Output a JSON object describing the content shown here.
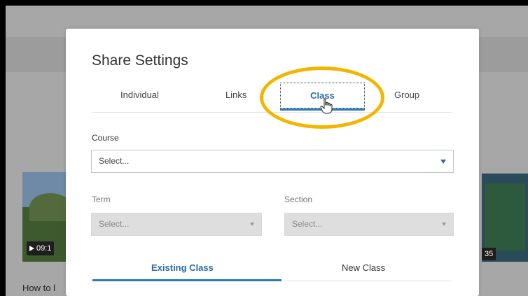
{
  "background": {
    "left_video_duration": "09:1",
    "right_video_duration": "35",
    "caption": "How to l"
  },
  "dialog": {
    "title": "Share Settings",
    "tabs": [
      "Individual",
      "Links",
      "Class",
      "Group"
    ],
    "active_tab": "Class",
    "course_label": "Course",
    "course_value": "Select...",
    "term_label": "Term",
    "term_value": "Select...",
    "section_label": "Section",
    "section_value": "Select...",
    "subtabs": [
      "Existing Class",
      "New Class"
    ],
    "active_subtab": "Existing Class"
  },
  "colors": {
    "accent": "#2a7ac0",
    "highlight": "#f2b600",
    "disabled_bg": "#dedede"
  }
}
